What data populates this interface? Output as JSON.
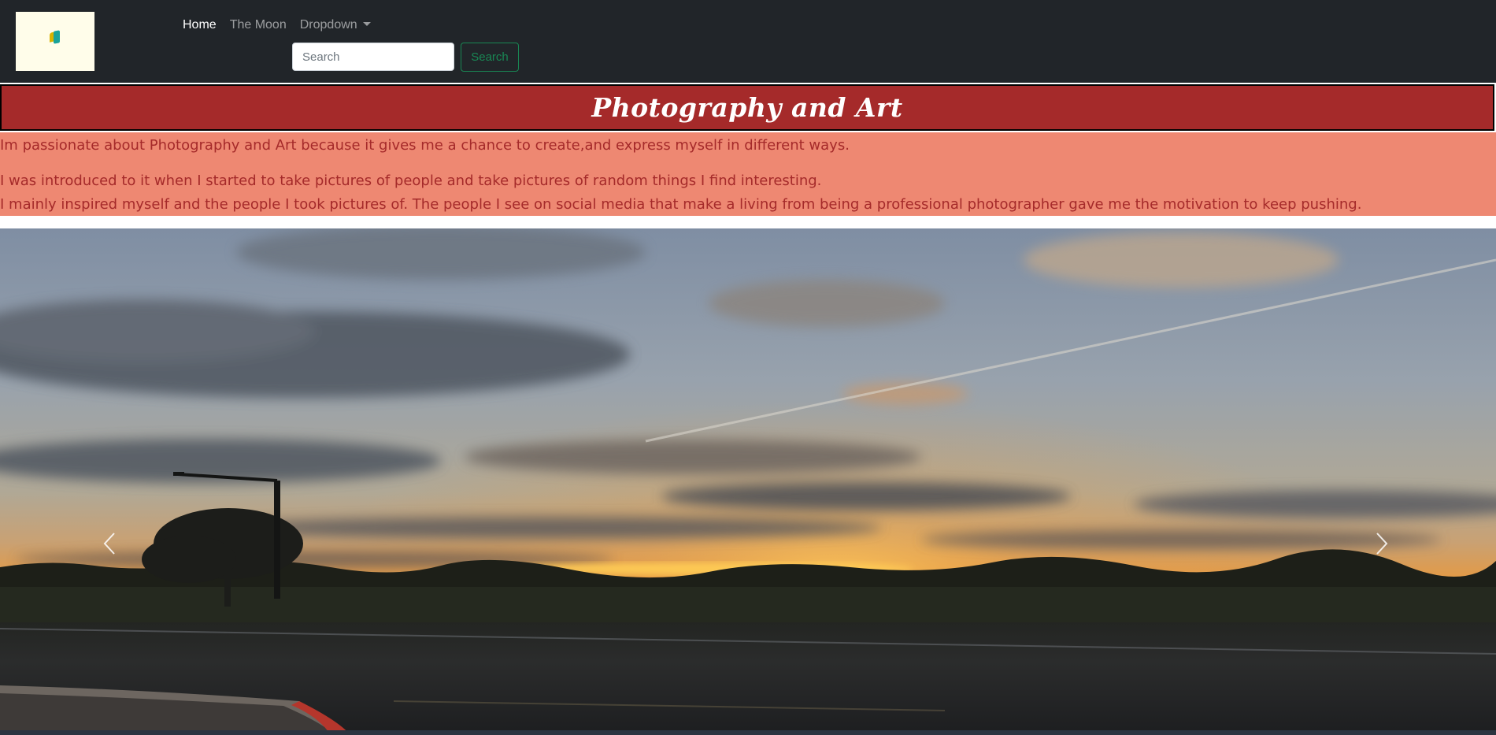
{
  "navbar": {
    "links": [
      {
        "label": "Home"
      },
      {
        "label": "The Moon"
      },
      {
        "label": "Dropdown"
      }
    ],
    "search": {
      "placeholder": "Search",
      "button_label": "Search"
    }
  },
  "banner": {
    "title": "Photography and Art"
  },
  "intro": {
    "paragraph_1": "Im passionate about Photography and Art because it gives me a chance to create,and express myself in different ways.",
    "paragraph_2": "I was introduced to it when I started to take pictures of people and take pictures of random things I find interesting.",
    "paragraph_3": "I mainly inspired myself and the people I took pictures of. The people I see on social media that make a living from being a professional photographer gave me the motivation to keep pushing."
  },
  "carousel": {
    "slide_description": "sunset over a field with trees, a street light and a road",
    "prev_icon": "chevron-left-icon",
    "next_icon": "chevron-right-icon"
  },
  "colors": {
    "navbar_bg": "#212529",
    "banner_bg": "#a52a2a",
    "intro_bg": "#ee8872",
    "intro_text": "#a52a2a",
    "search_accent": "#198754"
  }
}
